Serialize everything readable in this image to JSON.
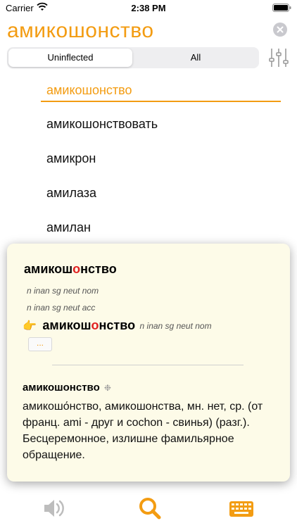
{
  "status": {
    "carrier": "Carrier",
    "time": "2:38 PM"
  },
  "search": {
    "query": "амикошонство"
  },
  "segment": {
    "options": [
      "Uninflected",
      "All"
    ],
    "selected": "Uninflected"
  },
  "results": [
    "амикошонство",
    "амикошонствовать",
    "амикрон",
    "амилаза",
    "амилан"
  ],
  "popup": {
    "headword_parts": [
      "амикош",
      "о",
      "нство"
    ],
    "forms": [
      "n inan sg neut nom",
      "n inan sg neut acc"
    ],
    "pointer_icon": "👉",
    "pointer_word_parts": [
      "амикош",
      "о",
      "нство"
    ],
    "pointer_gram": "n inan sg neut nom",
    "more_label": "...",
    "definition_title": "амикошонство",
    "definition_mark": "❉",
    "definition_body": "амикошо́нство, амикошонства, мн. нет, ср. (от франц. ami - друг и cochon - свинья) (разг.). Бесцеремонное, излишне фамильярное обращение."
  },
  "toolbar": {
    "icons": [
      "speaker-icon",
      "search-icon",
      "keyboard-icon"
    ]
  },
  "colors": {
    "accent": "#f39c12",
    "stress": "#e02020",
    "popup_bg": "#fdfbe8"
  }
}
